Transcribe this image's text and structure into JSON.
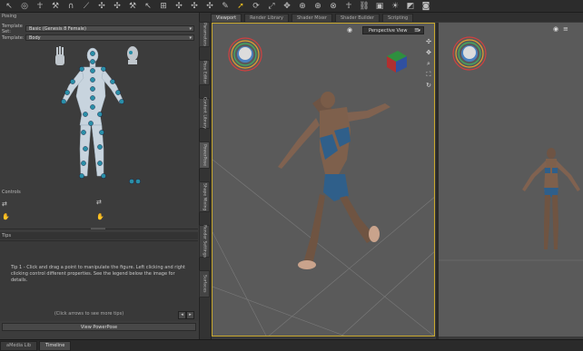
{
  "toolbar": {
    "icons": [
      "arrow-icon",
      "circle-icon",
      "pose-icon",
      "tool-icon",
      "magnet-icon",
      "line-icon",
      "node-icon",
      "node-icon",
      "hammer-icon",
      "arrow-icon",
      "align-icon",
      "node-icon",
      "node-icon",
      "node-icon",
      "wrench-icon",
      "select-icon",
      "rotate-icon",
      "scale-icon",
      "move-icon",
      "joint-icon",
      "joint-icon",
      "pin-icon",
      "pose-icon",
      "chain-icon",
      "camera-icon",
      "light-icon",
      "render-icon",
      "photo-icon"
    ]
  },
  "left_panel": {
    "title": "Posing",
    "template_set_label": "Template Set:",
    "template_set_value": "Basic (Genesis 8 Female)",
    "template_label": "Template:",
    "template_value": "Body",
    "controls_header": "Controls",
    "tips_header": "Tips",
    "tip_text": "Tip 1 - Click and drag a point to manipulate the figure. Left clicking and right clicking control different properties. See the legend below the image for details.",
    "tip_nav_text": "(Click arrows to see more tips)",
    "view_button": "View PowerPose"
  },
  "side_tabs": [
    "Parameters",
    "Pose Editor",
    "Content Library",
    "PowerPose",
    "Shape Mixing",
    "Render Settings",
    "Surfaces"
  ],
  "viewport_tabs": [
    "Viewport",
    "Render Library",
    "Shader Mixer",
    "Shader Builder",
    "Scripting"
  ],
  "viewport": {
    "camera": "Perspective View"
  },
  "bottom_tabs": [
    "aMedia Lib",
    "Timeline"
  ],
  "colors": {
    "accent": "#c9a92f",
    "control_point": "#2a8fa8",
    "figure": "#c8d4de",
    "skin": "#8a6a55",
    "bikini": "#2f5f8a"
  }
}
